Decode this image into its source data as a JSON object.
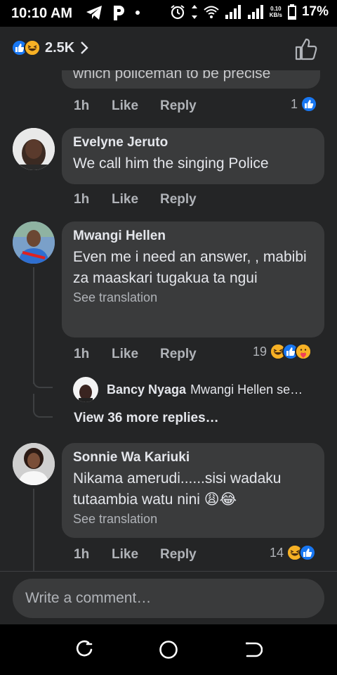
{
  "status_bar": {
    "time": "10:10 AM",
    "network_speed_value": "0.10",
    "network_speed_unit": "KB/s",
    "battery": "17%"
  },
  "header": {
    "reaction_count": "2.5K",
    "reaction_icons": [
      "like-icon",
      "haha-icon"
    ]
  },
  "comments": [
    {
      "partial_text": "which policeman to be precise",
      "time": "1h",
      "like_label": "Like",
      "reply_label": "Reply",
      "reaction_count": "1",
      "reactions": [
        "like-icon"
      ]
    },
    {
      "author": "Evelyne Jeruto",
      "text": "We call him the singing Police",
      "time": "1h",
      "like_label": "Like",
      "reply_label": "Reply"
    },
    {
      "author": "Mwangi Hellen",
      "text": "Even me i need an answer, , mabibi za maaskari tugakua ta ngui",
      "see_translation": "See translation",
      "time": "1h",
      "like_label": "Like",
      "reply_label": "Reply",
      "reaction_count": "19",
      "reactions": [
        "haha-icon",
        "like-icon",
        "care-icon"
      ],
      "reply_preview": {
        "author": "Bancy Nyaga",
        "text": "Mwangi Hellen se…"
      },
      "view_more": "View 36 more replies…"
    },
    {
      "author": "Sonnie Wa Kariuki",
      "text": "Nikama amerudi......sisi wadaku tutaambia watu nini 😩😂",
      "see_translation": "See translation",
      "time": "1h",
      "like_label": "Like",
      "reply_label": "Reply",
      "reaction_count": "14",
      "reactions": [
        "haha-icon",
        "like-icon"
      ]
    }
  ],
  "composer": {
    "placeholder": "Write a comment…"
  },
  "colors": {
    "background": "#242526",
    "bubble": "#3a3b3c",
    "text_primary": "#e4e6eb",
    "text_secondary": "#b0b3b8",
    "like_blue": "#1877f2",
    "haha_yellow": "#f7b125"
  }
}
